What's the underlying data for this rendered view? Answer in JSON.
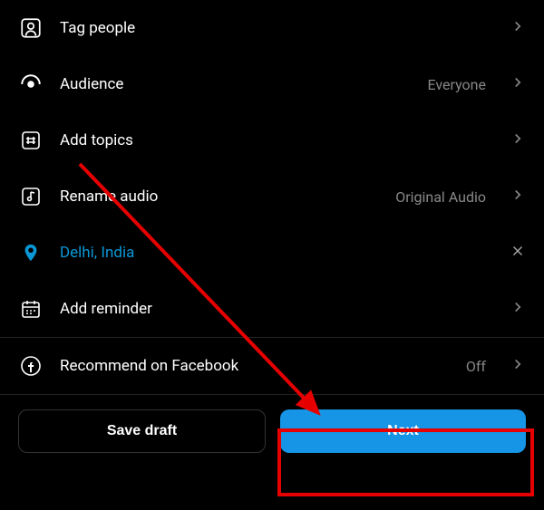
{
  "rows": {
    "tag_people": {
      "label": "Tag people"
    },
    "audience": {
      "label": "Audience",
      "value": "Everyone"
    },
    "add_topics": {
      "label": "Add topics"
    },
    "rename_audio": {
      "label": "Rename audio",
      "value": "Original Audio"
    },
    "location": {
      "label": "Delhi, India"
    },
    "add_reminder": {
      "label": "Add reminder"
    },
    "recommend_fb": {
      "label": "Recommend on Facebook",
      "value": "Off"
    }
  },
  "footer": {
    "save_draft": "Save draft",
    "next": "Next"
  },
  "colors": {
    "accent": "#1694e5",
    "location_text": "#0a97d6",
    "highlight": "#e60000"
  }
}
